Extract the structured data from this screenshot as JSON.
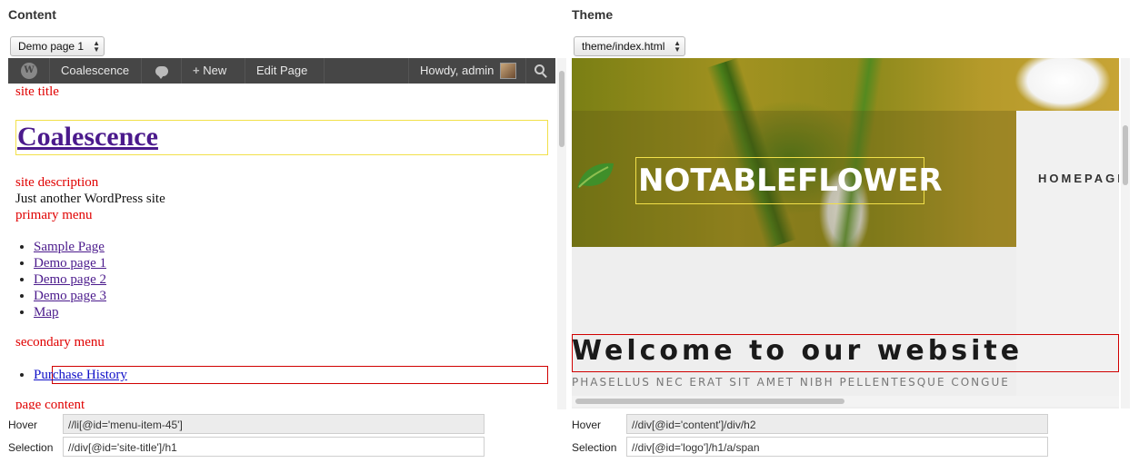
{
  "content_pane": {
    "title": "Content",
    "page_select": "Demo page 1",
    "adminbar": {
      "site_name": "Coalescence",
      "new_label": "New",
      "edit_label": "Edit Page",
      "howdy": "Howdy, admin"
    },
    "site_title_label": "site title",
    "site_title": "Coalescence",
    "site_description_label": "site description",
    "site_description": "Just another WordPress site",
    "primary_menu_label": "primary menu",
    "primary_menu": [
      "Sample Page",
      "Demo page 1",
      "Demo page 2",
      "Demo page 3",
      "Map"
    ],
    "secondary_menu_label": "secondary menu",
    "secondary_menu": [
      "Purchase History"
    ],
    "page_content_label": "page content"
  },
  "theme_pane": {
    "title": "Theme",
    "file_select": "theme/index.html",
    "logo_text": "NOTABLEFLOWER",
    "nav_home": "HOMEPAGE",
    "welcome": "Welcome to our website",
    "subtitle": "PHASELLUS NEC ERAT SIT AMET NIBH PELLENTESQUE CONGUE"
  },
  "fields": {
    "hover_label": "Hover",
    "selection_label": "Selection",
    "content_hover": "//li[@id='menu-item-45']",
    "content_selection": "//div[@id='site-title']/h1",
    "theme_hover": "//div[@id='content']/div/h2",
    "theme_selection": "//div[@id='logo']/h1/a/span"
  },
  "colors": {
    "hover_outline": "#d00000",
    "selection_outline": "#f2e04a",
    "adminbar": "#464646",
    "label_red": "#e00000"
  }
}
